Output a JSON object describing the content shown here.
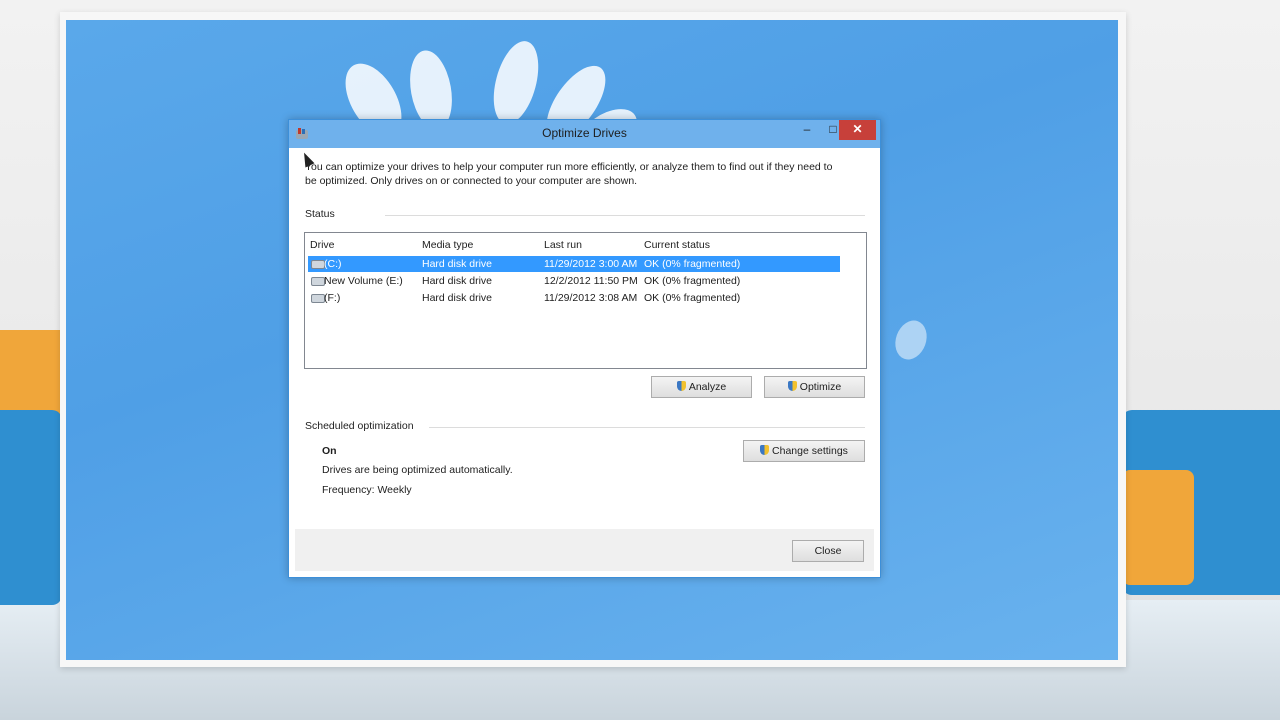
{
  "window": {
    "title": "Optimize Drives",
    "minimize_glyph": "–",
    "maximize_glyph": "□",
    "close_glyph": "✕"
  },
  "intro_text": "You can optimize your drives to help your computer run more efficiently, or analyze them to find out if they need to be optimized. Only drives on or connected to your computer are shown.",
  "status": {
    "label": "Status",
    "columns": [
      "Drive",
      "Media type",
      "Last run",
      "Current status"
    ],
    "rows": [
      {
        "drive": "(C:)",
        "media_type": "Hard disk drive",
        "last_run": "11/29/2012 3:00 AM",
        "current_status": "OK (0% fragmented)",
        "selected": true
      },
      {
        "drive": "New Volume (E:)",
        "media_type": "Hard disk drive",
        "last_run": "12/2/2012 11:50 PM",
        "current_status": "OK (0% fragmented)",
        "selected": false
      },
      {
        "drive": "(F:)",
        "media_type": "Hard disk drive",
        "last_run": "11/29/2012 3:08 AM",
        "current_status": "OK (0% fragmented)",
        "selected": false
      }
    ]
  },
  "buttons": {
    "analyze": "Analyze",
    "optimize": "Optimize",
    "change_settings": "Change settings",
    "close": "Close"
  },
  "schedule": {
    "label": "Scheduled optimization",
    "state": "On",
    "description": "Drives are being optimized automatically.",
    "frequency": "Frequency: Weekly"
  },
  "colors": {
    "selection": "#3399ff",
    "titlebar": "#6fb1ec",
    "close_button": "#c7403a",
    "desktop": "#4f9fe6"
  }
}
